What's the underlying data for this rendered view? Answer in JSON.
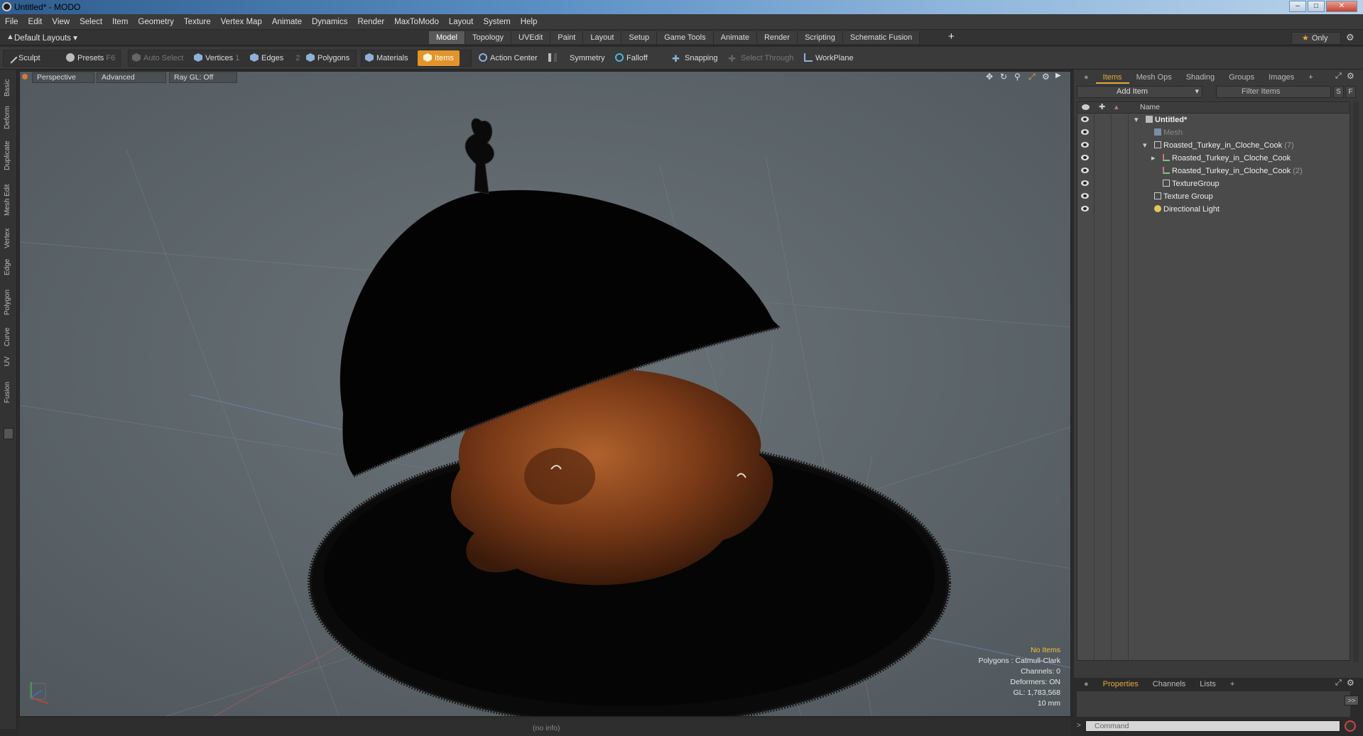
{
  "window": {
    "title": "Untitled* - MODO",
    "min": "–",
    "max": "□",
    "close": "✕"
  },
  "menu": [
    "File",
    "Edit",
    "View",
    "Select",
    "Item",
    "Geometry",
    "Texture",
    "Vertex Map",
    "Animate",
    "Dynamics",
    "Render",
    "MaxToModo",
    "Layout",
    "System",
    "Help"
  ],
  "layout_selector": "Default Layouts ▾",
  "tabs": [
    "Model",
    "Topology",
    "UVEdit",
    "Paint",
    "Layout",
    "Setup",
    "Game Tools",
    "Animate",
    "Render",
    "Scripting",
    "Schematic Fusion"
  ],
  "active_tab": "Model",
  "only_label": "Only",
  "toolbar": {
    "sculpt": "Sculpt",
    "presets": "Presets",
    "presets_key": "F6",
    "auto_select": "Auto Select",
    "vertices": "Vertices",
    "vertices_key": "1",
    "edges": "Edges",
    "edges_key": "2",
    "polygons": "Polygons",
    "materials": "Materials",
    "items": "Items",
    "action_center": "Action Center",
    "symmetry": "Symmetry",
    "falloff": "Falloff",
    "snapping": "Snapping",
    "select_through": "Select Through",
    "workplane": "WorkPlane"
  },
  "left_tabs": [
    "Basic",
    "Deform",
    "Duplicate",
    "Mesh Edit",
    "Vertex",
    "Edge",
    "Polygon",
    "Curve",
    "UV",
    "Fusion"
  ],
  "viewport": {
    "view": "Perspective",
    "shading": "Advanced",
    "raygl": "Ray GL: Off",
    "info": {
      "selection": "No Items",
      "polygons": "Polygons : Catmull-Clark",
      "channels": "Channels: 0",
      "deformers": "Deformers: ON",
      "gl": "GL: 1,783,568",
      "unit": "10 mm"
    }
  },
  "status": "(no info)",
  "right_panel": {
    "tabs": [
      "Items",
      "Mesh Ops",
      "Shading",
      "Groups",
      "Images",
      "+"
    ],
    "add_item": "Add Item",
    "filter_items": "Filter Items",
    "s_btn": "S",
    "f_btn": "F",
    "column_name": "Name",
    "tree": [
      {
        "label": "Untitled*",
        "count": ""
      },
      {
        "label": "Mesh",
        "count": ""
      },
      {
        "label": "Roasted_Turkey_in_Cloche_Cook",
        "count": "(7)"
      },
      {
        "label": "Roasted_Turkey_in_Cloche_Cook",
        "count": ""
      },
      {
        "label": "Roasted_Turkey_in_Cloche_Cook",
        "count": "(2)"
      },
      {
        "label": "TextureGroup",
        "count": ""
      },
      {
        "label": "Texture Group",
        "count": ""
      },
      {
        "label": "Directional Light",
        "count": ""
      }
    ]
  },
  "bottom_panel": {
    "tabs": [
      "Properties",
      "Channels",
      "Lists",
      "+"
    ],
    "command_placeholder": "Command",
    "expand": ">>"
  },
  "colors": {
    "accent": "#e2942b",
    "viewport_bg": "#5a6268"
  }
}
